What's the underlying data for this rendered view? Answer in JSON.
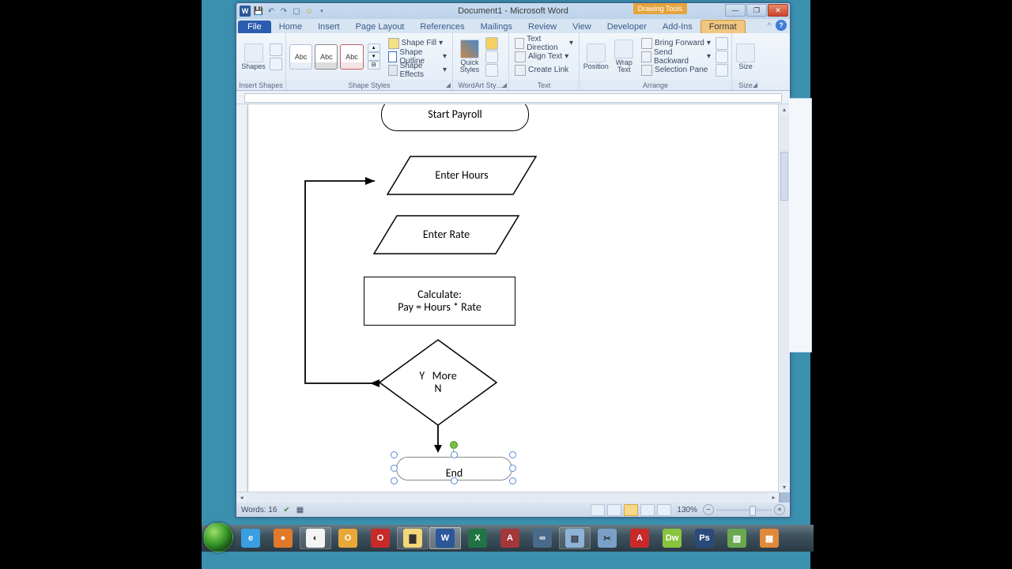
{
  "title": "Document1 - Microsoft Word",
  "contextual_tab_group": "Drawing Tools",
  "tabs": {
    "file": "File",
    "home": "Home",
    "insert": "Insert",
    "pagelayout": "Page Layout",
    "references": "References",
    "mailings": "Mailings",
    "review": "Review",
    "view": "View",
    "developer": "Developer",
    "addins": "Add-Ins",
    "format": "Format"
  },
  "ribbon": {
    "group_insert_shapes": "Insert Shapes",
    "shapes_btn": "Shapes",
    "group_shape_styles": "Shape Styles",
    "abc": "Abc",
    "shape_fill": "Shape Fill",
    "shape_outline": "Shape Outline",
    "shape_effects": "Shape Effects",
    "group_wordart": "WordArt Sty…",
    "quick_styles": "Quick Styles",
    "group_text": "Text",
    "text_direction": "Text Direction",
    "align_text": "Align Text",
    "create_link": "Create Link",
    "group_arrange": "Arrange",
    "position": "Position",
    "wrap_text": "Wrap Text",
    "bring_forward": "Bring Forward",
    "send_backward": "Send Backward",
    "selection_pane": "Selection Pane",
    "group_size": "Size",
    "size": "Size"
  },
  "flow": {
    "start": "Start Payroll",
    "hours": "Enter Hours",
    "rate": "Enter Rate",
    "calc1": "Calculate:",
    "calc2": "Pay = Hours * Rate",
    "dec1": "Y   More",
    "dec2": "N",
    "end": "End"
  },
  "status": {
    "words_lbl": "Words:",
    "words": "16",
    "zoom": "130%"
  },
  "taskbar": {
    "apps": [
      {
        "name": "ie",
        "color": "#3a9ee0",
        "letter": "e"
      },
      {
        "name": "firefox",
        "color": "#e07a2a",
        "letter": "●"
      },
      {
        "name": "chrome",
        "color": "#f4f4f4",
        "letter": "◐"
      },
      {
        "name": "outlook",
        "color": "#e8a838",
        "letter": "O"
      },
      {
        "name": "opera",
        "color": "#c82a2a",
        "letter": "O"
      },
      {
        "name": "explorer",
        "color": "#f3d67a",
        "letter": "▇"
      },
      {
        "name": "word",
        "color": "#2b579a",
        "letter": "W"
      },
      {
        "name": "excel",
        "color": "#217346",
        "letter": "X"
      },
      {
        "name": "access",
        "color": "#a4373a",
        "letter": "A"
      },
      {
        "name": "link",
        "color": "#4a6a8a",
        "letter": "∞"
      },
      {
        "name": "notepad",
        "color": "#8db4d8",
        "letter": "▤"
      },
      {
        "name": "snip",
        "color": "#7aa0c8",
        "letter": "✂"
      },
      {
        "name": "acrobat",
        "color": "#c82a2a",
        "letter": "A"
      },
      {
        "name": "dreamweaver",
        "color": "#88c440",
        "letter": "Dw"
      },
      {
        "name": "photoshop",
        "color": "#2a4a7a",
        "letter": "Ps"
      },
      {
        "name": "app1",
        "color": "#6aa84f",
        "letter": "▧"
      },
      {
        "name": "app2",
        "color": "#e0893a",
        "letter": "▦"
      }
    ]
  }
}
